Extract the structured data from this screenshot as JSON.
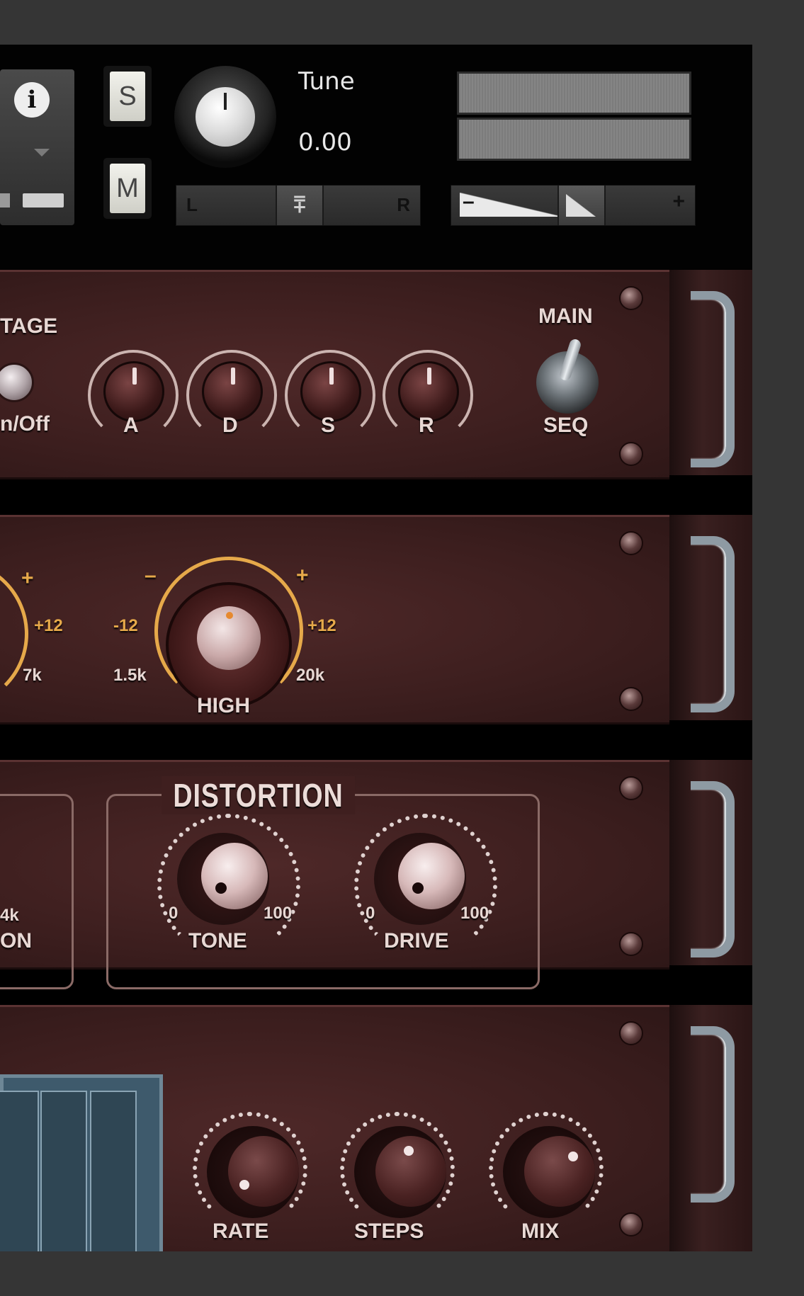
{
  "header": {
    "info_icon": "info-icon",
    "solo_label": "S",
    "mute_label": "M",
    "tune_label": "Tune",
    "tune_value": "0.00",
    "pan_left": "L",
    "pan_right": "R",
    "pan_thumb": "⩱",
    "vol_minus": "–",
    "vol_plus": "+"
  },
  "envelope": {
    "section_label": "TAGE",
    "onoff_label": "n/Off",
    "knobs": [
      "A",
      "D",
      "S",
      "R"
    ],
    "switch_top": "MAIN",
    "switch_bottom": "SEQ"
  },
  "eq": {
    "left_plus": "+",
    "left_max": "+12",
    "left_freq": "7k",
    "high_minus": "–",
    "high_plus": "+",
    "high_min": "-12",
    "high_max": "+12",
    "high_freq_min": "1.5k",
    "high_freq_max": "20k",
    "high_label": "HIGH"
  },
  "distortion": {
    "left_freq": "4k",
    "left_label": "ON",
    "title": "DISTORTION",
    "tone_min": "0",
    "tone_max": "100",
    "tone_label": "TONE",
    "drive_min": "0",
    "drive_max": "100",
    "drive_label": "DRIVE"
  },
  "sequencer": {
    "knobs": [
      "RATE",
      "STEPS",
      "MIX"
    ]
  },
  "colors": {
    "accent": "#e6a94a",
    "rack": "#3c1e1e",
    "screen": "#3e5a6c"
  }
}
